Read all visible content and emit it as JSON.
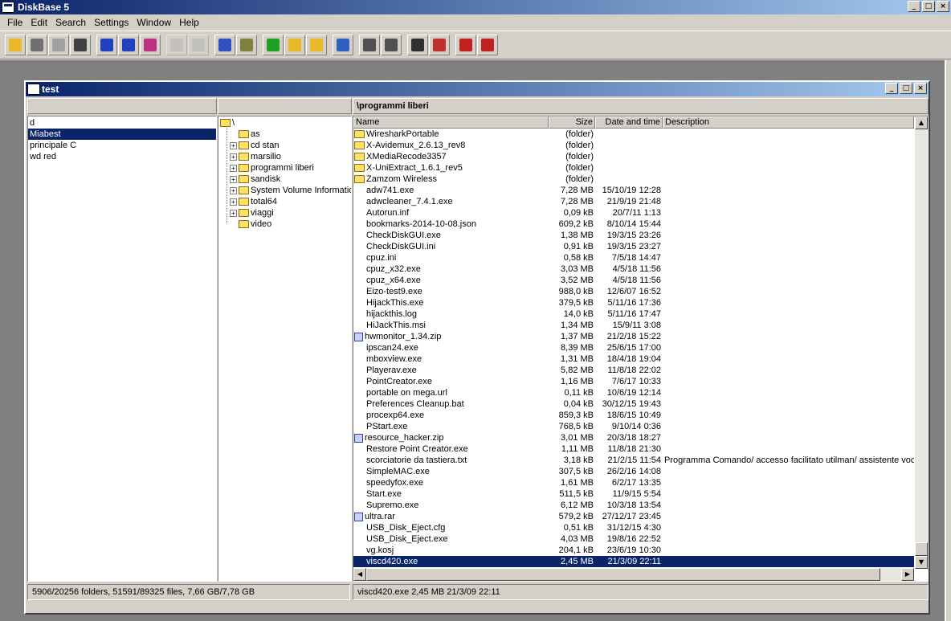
{
  "app": {
    "title": "DiskBase 5"
  },
  "menu": [
    "File",
    "Edit",
    "Search",
    "Settings",
    "Window",
    "Help"
  ],
  "toolbar": {
    "buttons": [
      {
        "icon": "open-folder-icon",
        "color": "#e8b828"
      },
      {
        "icon": "print-icon",
        "color": "#707070"
      },
      {
        "icon": "catalog-icon",
        "color": "#a0a0a0"
      },
      {
        "icon": "catalog-list-icon",
        "color": "#404040"
      },
      {
        "icon": "scan-icon",
        "color": "#2040c0"
      },
      {
        "icon": "update-icon",
        "color": "#2040c0"
      },
      {
        "icon": "filter-icon",
        "color": "#c03080"
      },
      {
        "icon": "copy-icon",
        "color": "#b0b0b0",
        "disabled": true
      },
      {
        "icon": "move-icon",
        "color": "#b0b0b0",
        "disabled": true
      },
      {
        "icon": "properties-icon",
        "color": "#3050c0"
      },
      {
        "icon": "find-icon",
        "color": "#808040"
      },
      {
        "icon": "tree-icon",
        "color": "#20a020"
      },
      {
        "icon": "folder-up-icon",
        "color": "#e8b828"
      },
      {
        "icon": "folder-open-icon",
        "color": "#e8b828"
      },
      {
        "icon": "go-up-icon",
        "color": "#3060c0"
      },
      {
        "icon": "view-split-icon",
        "color": "#505050"
      },
      {
        "icon": "view-list-icon",
        "color": "#505050"
      },
      {
        "icon": "select-all-icon",
        "color": "#303030"
      },
      {
        "icon": "unselect-icon",
        "color": "#c03030"
      },
      {
        "icon": "export-icon",
        "color": "#c02020"
      },
      {
        "icon": "import-icon",
        "color": "#c02020"
      }
    ]
  },
  "window": {
    "title": "test"
  },
  "pane_headers": {
    "left": "",
    "middle": "",
    "right": "\\programmi liberi"
  },
  "drives": [
    {
      "label": "d",
      "selected": false
    },
    {
      "label": "Miabest",
      "selected": true
    },
    {
      "label": "principale C",
      "selected": false
    },
    {
      "label": "wd red",
      "selected": false
    }
  ],
  "tree": {
    "root": "\\",
    "children": [
      {
        "label": "as",
        "expandable": false
      },
      {
        "label": "cd stan",
        "expandable": true
      },
      {
        "label": "marsilio",
        "expandable": true
      },
      {
        "label": "programmi liberi",
        "expandable": true
      },
      {
        "label": "sandisk",
        "expandable": true
      },
      {
        "label": "System Volume Information",
        "expandable": true
      },
      {
        "label": "total64",
        "expandable": true
      },
      {
        "label": "viaggi",
        "expandable": true
      },
      {
        "label": "video",
        "expandable": false
      }
    ]
  },
  "columns": [
    "Name",
    "Size",
    "Date and time",
    "Description"
  ],
  "files": [
    {
      "name": "WiresharkPortable",
      "size": "(folder)",
      "date": "",
      "desc": "",
      "type": "folder"
    },
    {
      "name": "X-Avidemux_2.6.13_rev8",
      "size": "(folder)",
      "date": "",
      "desc": "",
      "type": "folder"
    },
    {
      "name": "XMediaRecode3357",
      "size": "(folder)",
      "date": "",
      "desc": "",
      "type": "folder"
    },
    {
      "name": "X-UniExtract_1.6.1_rev5",
      "size": "(folder)",
      "date": "",
      "desc": "",
      "type": "folder"
    },
    {
      "name": "Zamzom Wireless",
      "size": "(folder)",
      "date": "",
      "desc": "",
      "type": "folder"
    },
    {
      "name": "adw741.exe",
      "size": "7,28 MB",
      "date": "15/10/19 12:28",
      "desc": "",
      "type": "file"
    },
    {
      "name": "adwcleaner_7.4.1.exe",
      "size": "7,28 MB",
      "date": "21/9/19 21:48",
      "desc": "",
      "type": "file"
    },
    {
      "name": "Autorun.inf",
      "size": "0,09 kB",
      "date": "20/7/11  1:13",
      "desc": "",
      "type": "file"
    },
    {
      "name": "bookmarks-2014-10-08.json",
      "size": "609,2 kB",
      "date": "8/10/14 15:44",
      "desc": "",
      "type": "file"
    },
    {
      "name": "CheckDiskGUI.exe",
      "size": "1,38 MB",
      "date": "19/3/15 23:26",
      "desc": "",
      "type": "file"
    },
    {
      "name": "CheckDiskGUI.ini",
      "size": "0,91 kB",
      "date": "19/3/15 23:27",
      "desc": "",
      "type": "file"
    },
    {
      "name": "cpuz.ini",
      "size": "0,58 kB",
      "date": "7/5/18 14:47",
      "desc": "",
      "type": "file"
    },
    {
      "name": "cpuz_x32.exe",
      "size": "3,03 MB",
      "date": "4/5/18 11:56",
      "desc": "",
      "type": "file"
    },
    {
      "name": "cpuz_x64.exe",
      "size": "3,52 MB",
      "date": "4/5/18 11:56",
      "desc": "",
      "type": "file"
    },
    {
      "name": "Eizo-test9.exe",
      "size": "988,0 kB",
      "date": "12/6/07 16:52",
      "desc": "",
      "type": "file"
    },
    {
      "name": "HijackThis.exe",
      "size": "379,5 kB",
      "date": "5/11/16 17:36",
      "desc": "",
      "type": "file"
    },
    {
      "name": "hijackthis.log",
      "size": "14,0 kB",
      "date": "5/11/16 17:47",
      "desc": "",
      "type": "file"
    },
    {
      "name": "HiJackThis.msi",
      "size": "1,34 MB",
      "date": "15/9/11  3:08",
      "desc": "",
      "type": "file"
    },
    {
      "name": "hwmonitor_1.34.zip",
      "size": "1,37 MB",
      "date": "21/2/18 15:22",
      "desc": "",
      "type": "zip"
    },
    {
      "name": "ipscan24.exe",
      "size": "8,39 MB",
      "date": "25/6/15 17:00",
      "desc": "",
      "type": "file"
    },
    {
      "name": "mboxview.exe",
      "size": "1,31 MB",
      "date": "18/4/18 19:04",
      "desc": "",
      "type": "file"
    },
    {
      "name": "Playerav.exe",
      "size": "5,82 MB",
      "date": "11/8/18 22:02",
      "desc": "",
      "type": "file"
    },
    {
      "name": "PointCreator.exe",
      "size": "1,16 MB",
      "date": "7/6/17 10:33",
      "desc": "",
      "type": "file"
    },
    {
      "name": "portable on mega.url",
      "size": "0,11 kB",
      "date": "10/6/19 12:14",
      "desc": "",
      "type": "file"
    },
    {
      "name": "Preferences Cleanup.bat",
      "size": "0,04 kB",
      "date": "30/12/15 19:43",
      "desc": "",
      "type": "file"
    },
    {
      "name": "procexp64.exe",
      "size": "859,3 kB",
      "date": "18/6/15 10:49",
      "desc": "",
      "type": "file"
    },
    {
      "name": "PStart.exe",
      "size": "768,5 kB",
      "date": "9/10/14  0:36",
      "desc": "",
      "type": "file"
    },
    {
      "name": "resource_hacker.zip",
      "size": "3,01 MB",
      "date": "20/3/18 18:27",
      "desc": "",
      "type": "zip"
    },
    {
      "name": "Restore Point Creator.exe",
      "size": "1,11 MB",
      "date": "11/8/18 21:30",
      "desc": "",
      "type": "file"
    },
    {
      "name": "scorciatorie da tastiera.txt",
      "size": "3,18 kB",
      "date": "21/2/15 11:54",
      "desc": "Programma Comando/ accesso facilitato utilman/ assistente vocale",
      "type": "file"
    },
    {
      "name": "SimpleMAC.exe",
      "size": "307,5 kB",
      "date": "26/2/16 14:08",
      "desc": "",
      "type": "file"
    },
    {
      "name": "speedyfox.exe",
      "size": "1,61 MB",
      "date": "6/2/17 13:35",
      "desc": "",
      "type": "file"
    },
    {
      "name": "Start.exe",
      "size": "511,5 kB",
      "date": "11/9/15  5:54",
      "desc": "",
      "type": "file"
    },
    {
      "name": "Supremo.exe",
      "size": "6,12 MB",
      "date": "10/3/18 13:54",
      "desc": "",
      "type": "file"
    },
    {
      "name": "ultra.rar",
      "size": "579,2 kB",
      "date": "27/12/17 23:45",
      "desc": "",
      "type": "zip"
    },
    {
      "name": "USB_Disk_Eject.cfg",
      "size": "0,51 kB",
      "date": "31/12/15  4:30",
      "desc": "",
      "type": "file"
    },
    {
      "name": "USB_Disk_Eject.exe",
      "size": "4,03 MB",
      "date": "19/8/16 22:52",
      "desc": "",
      "type": "file"
    },
    {
      "name": "vg.kosj",
      "size": "204,1 kB",
      "date": "23/6/19 10:30",
      "desc": "",
      "type": "file"
    },
    {
      "name": "viscd420.exe",
      "size": "2,45 MB",
      "date": "21/3/09 22:11",
      "desc": "",
      "type": "file",
      "selected": true
    }
  ],
  "status": {
    "left": "5906/20256 folders, 51591/89325 files, 7,66 GB/7,78 GB",
    "right": "viscd420.exe    2,45 MB    21/3/09 22:11"
  },
  "colors": {
    "selection": "#0a246a",
    "folder": "#ffdf6b",
    "titlebar": "#0a246a"
  }
}
